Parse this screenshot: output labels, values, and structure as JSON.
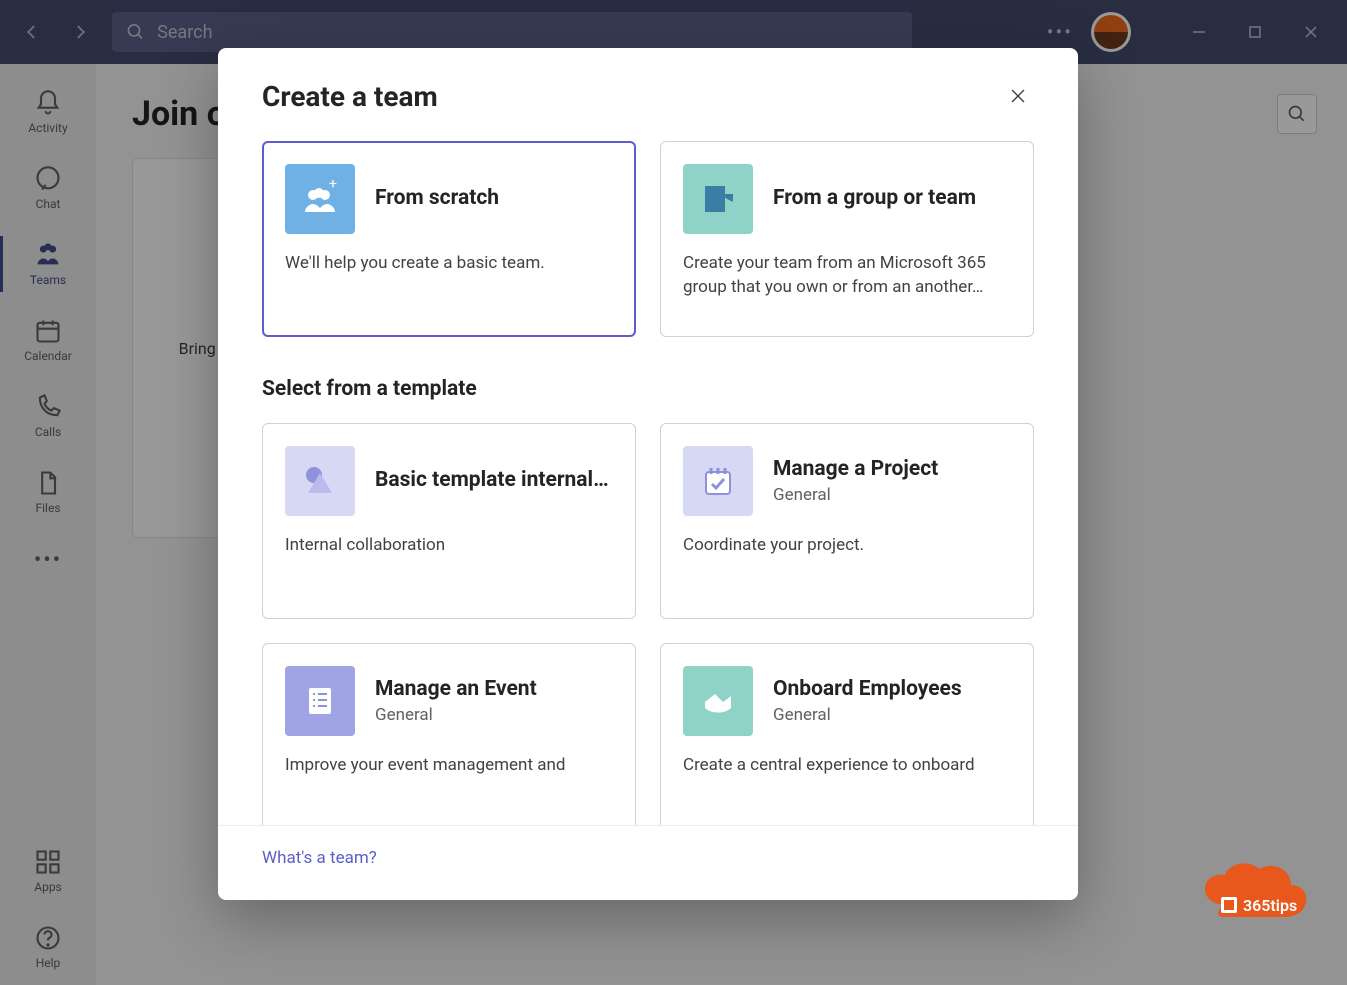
{
  "titlebar": {
    "search_placeholder": "Search"
  },
  "rail": {
    "items": [
      {
        "label": "Activity"
      },
      {
        "label": "Chat"
      },
      {
        "label": "Teams"
      },
      {
        "label": "Calendar"
      },
      {
        "label": "Calls"
      },
      {
        "label": "Files"
      }
    ],
    "apps_label": "Apps",
    "help_label": "Help"
  },
  "main": {
    "heading": "Join or create a team",
    "join_text": "Bring everyone together and get to work!"
  },
  "modal": {
    "title": "Create a team",
    "primary_cards": [
      {
        "title": "From scratch",
        "desc": "We'll help you create a basic team."
      },
      {
        "title": "From a group or team",
        "desc": "Create your team from an Microsoft 365 group that you own or from an another…"
      }
    ],
    "template_heading": "Select from a template",
    "template_cards": [
      {
        "title": "Basic template internal…",
        "sub": "",
        "desc": "Internal collaboration"
      },
      {
        "title": "Manage a Project",
        "sub": "General",
        "desc": "Coordinate your project."
      },
      {
        "title": "Manage an Event",
        "sub": "General",
        "desc": "Improve your event management and"
      },
      {
        "title": "Onboard Employees",
        "sub": "General",
        "desc": "Create a central experience to onboard"
      }
    ],
    "footer_link": "What's a team?"
  },
  "tips_badge": "365tips"
}
